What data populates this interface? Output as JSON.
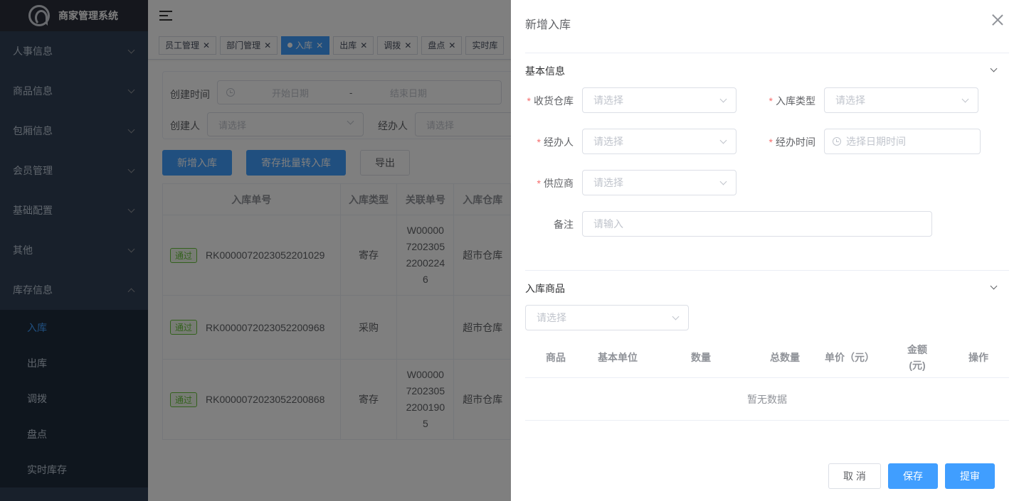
{
  "app": {
    "title": "商家管理系统"
  },
  "sidebar": {
    "menus": [
      {
        "label": "人事信息"
      },
      {
        "label": "商品信息"
      },
      {
        "label": "包厢信息"
      },
      {
        "label": "会员管理"
      },
      {
        "label": "基础配置"
      },
      {
        "label": "其他"
      },
      {
        "label": "库存信息"
      }
    ],
    "submenu": [
      {
        "label": "入库"
      },
      {
        "label": "出库"
      },
      {
        "label": "调拨"
      },
      {
        "label": "盘点"
      },
      {
        "label": "实时库存"
      }
    ]
  },
  "tags": [
    {
      "label": "员工管理"
    },
    {
      "label": "部门管理"
    },
    {
      "label": "入库"
    },
    {
      "label": "出库"
    },
    {
      "label": "调拨"
    },
    {
      "label": "盘点"
    },
    {
      "label": "实时库"
    }
  ],
  "search": {
    "create_time_label": "创建时间",
    "start_date_placeholder": "开始日期",
    "range_sep": "-",
    "end_date_placeholder": "结束日期",
    "creator_label": "创建人",
    "creator_placeholder": "请选择",
    "handler_label": "经办人",
    "handler_placeholder": "请选择"
  },
  "actions": {
    "add_label": "新增入库",
    "batch_label": "寄存批量转入库",
    "export_label": "导出"
  },
  "table": {
    "headers": [
      "入库单号",
      "入库类型",
      "关联单号",
      "入库仓库"
    ],
    "rows": [
      {
        "status": "通过",
        "no": "RK0000072023052201029",
        "type": "寄存",
        "rel": [
          "W00000",
          "7202305",
          "2200224",
          "6"
        ],
        "wh": "超市仓库"
      },
      {
        "status": "通过",
        "no": "RK0000072023052200968",
        "type": "采购",
        "rel": [],
        "wh": "超市仓库"
      },
      {
        "status": "通过",
        "no": "RK0000072023052200868",
        "type": "寄存",
        "rel": [
          "W00000",
          "7202305",
          "2200190",
          "5"
        ],
        "wh": "超市仓库"
      }
    ]
  },
  "drawer": {
    "title": "新增入库",
    "basic_section": "基本信息",
    "fields": {
      "warehouse_label": "收货仓库",
      "warehouse_placeholder": "请选择",
      "type_label": "入库类型",
      "type_placeholder": "请选择",
      "handler_label": "经办人",
      "handler_placeholder": "请选择",
      "handle_time_label": "经办时间",
      "handle_time_placeholder": "选择日期时间",
      "supplier_label": "供应商",
      "supplier_placeholder": "请选择",
      "remark_label": "备注",
      "remark_placeholder": "请输入"
    },
    "goods_section": "入库商品",
    "goods_select_placeholder": "请选择",
    "goods_headers": [
      "商品",
      "基本单位",
      "数量",
      "总数量",
      "单价（元）",
      "金额",
      "(元)",
      "操作"
    ],
    "empty_text": "暂无数据",
    "cancel_label": "取 消",
    "save_label": "保存",
    "submit_label": "提审"
  }
}
